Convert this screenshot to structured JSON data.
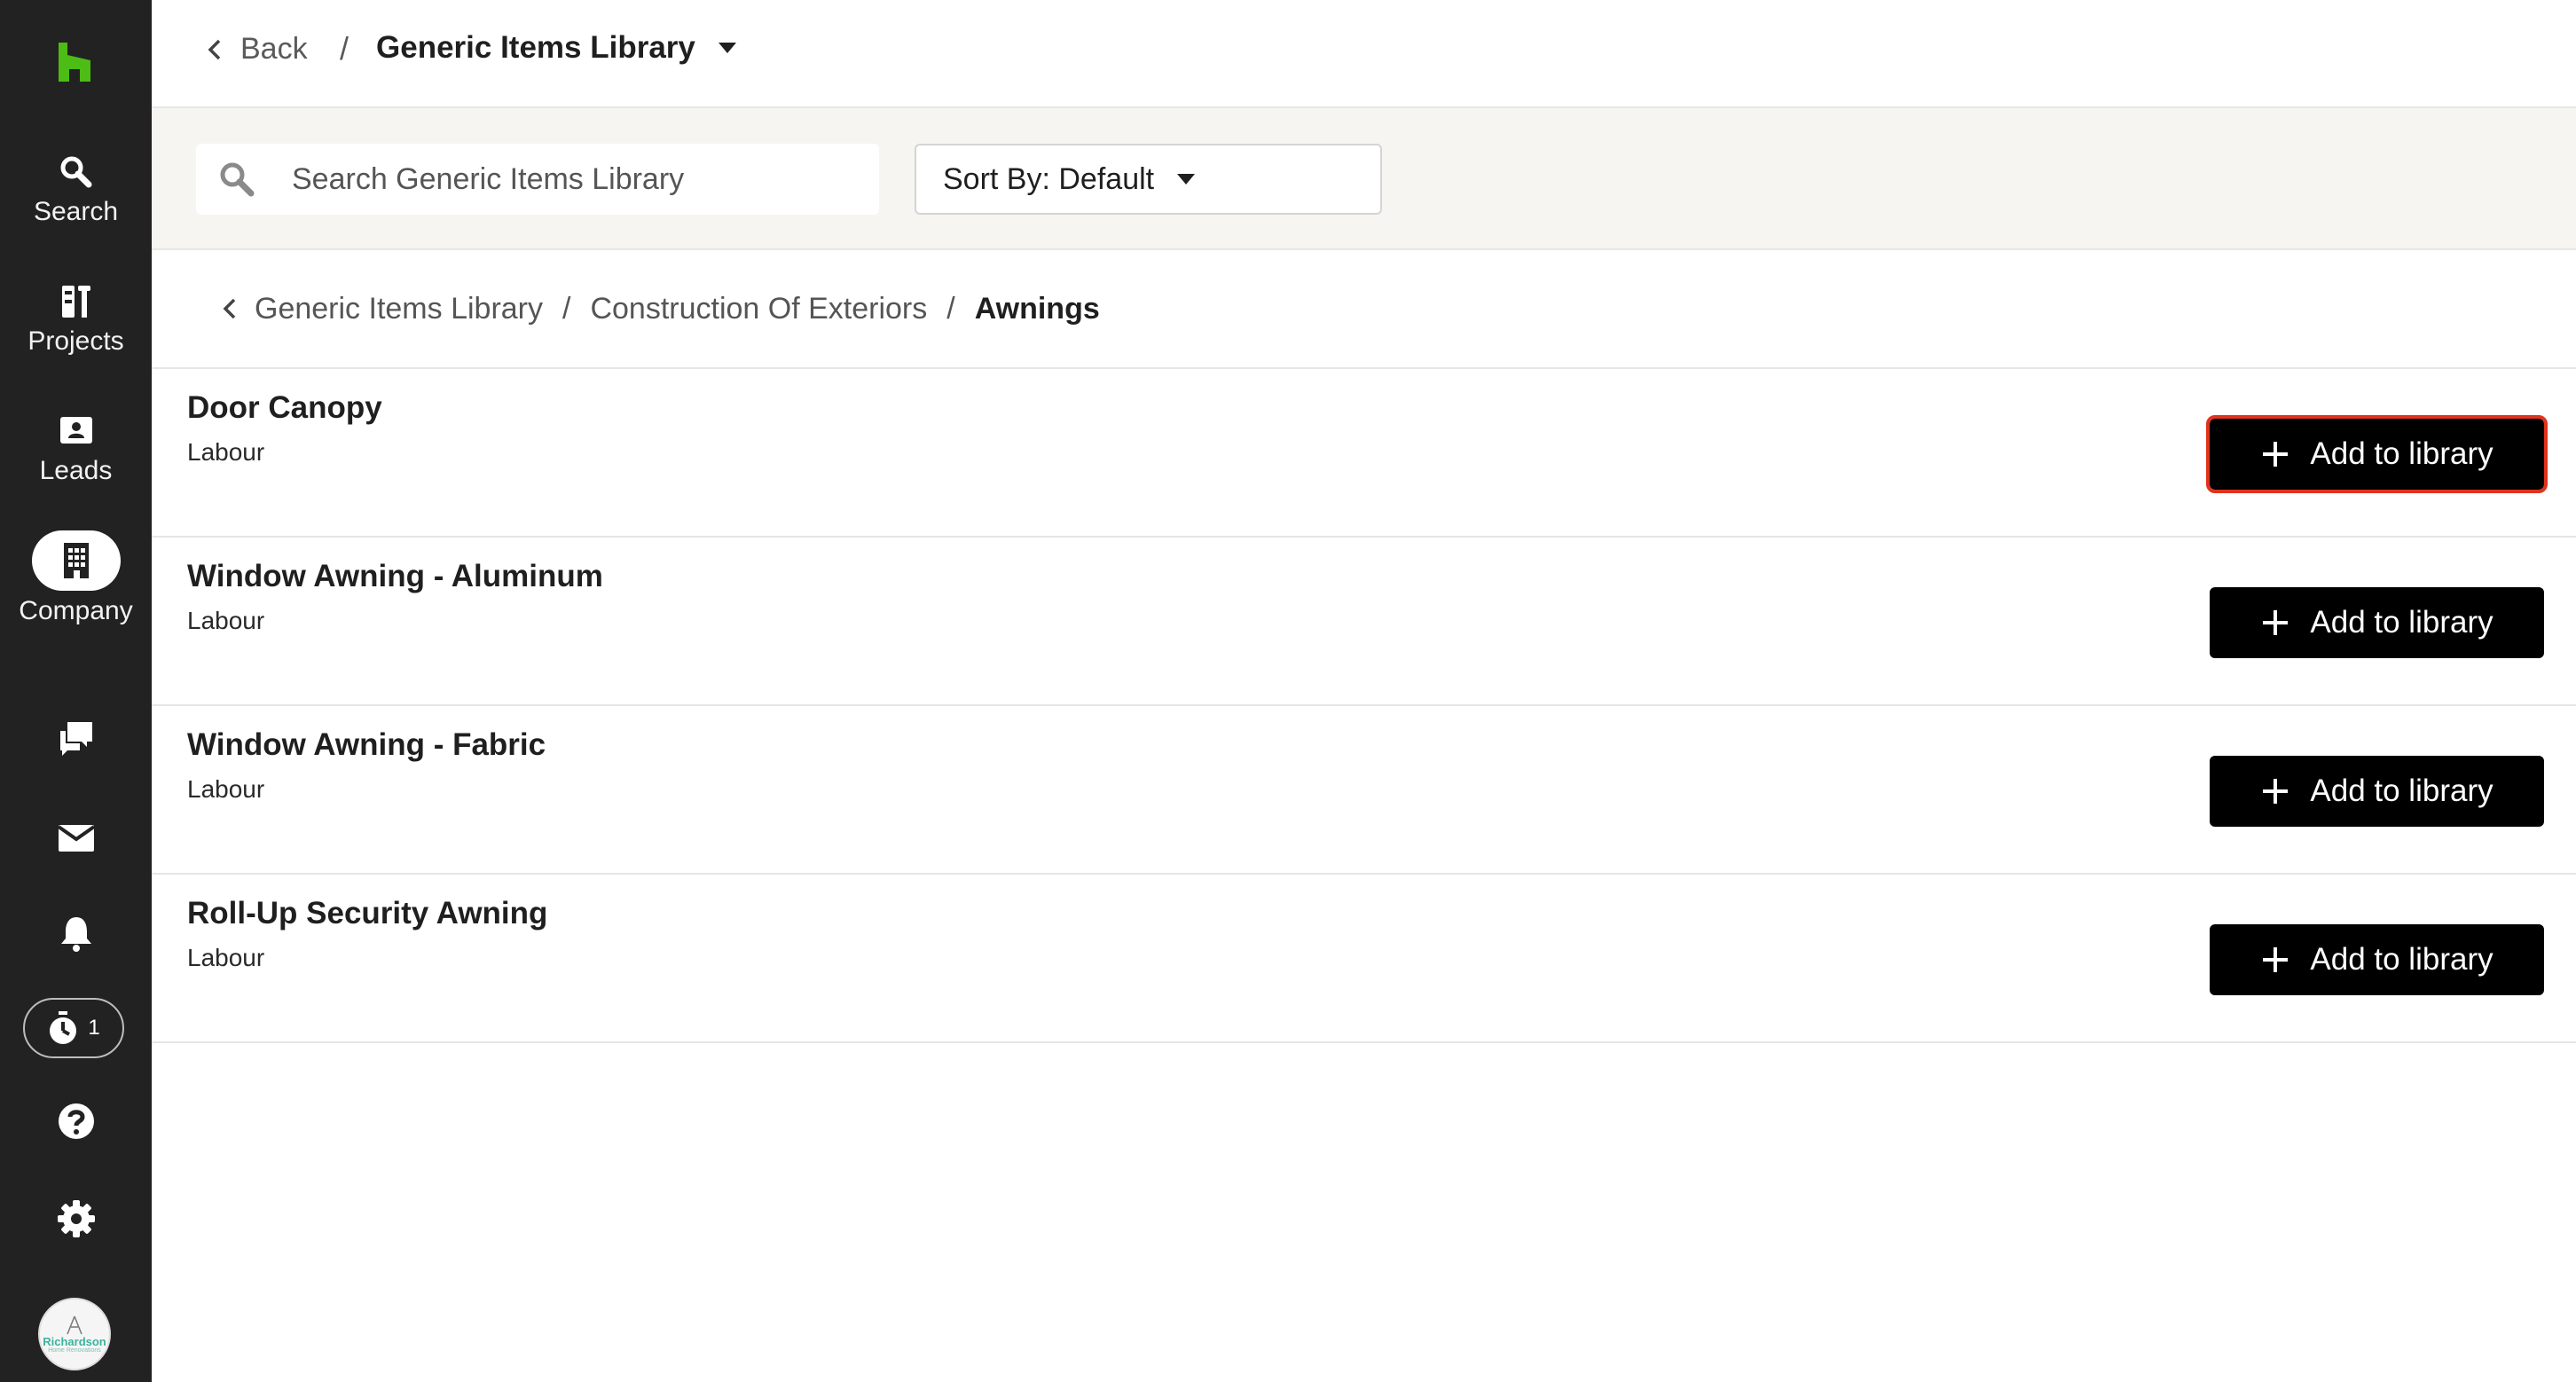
{
  "sidebar": {
    "logo": "houzz-logo",
    "items": [
      {
        "label": "Search",
        "icon": "search-icon"
      },
      {
        "label": "Projects",
        "icon": "projects-icon"
      },
      {
        "label": "Leads",
        "icon": "leads-icon"
      },
      {
        "label": "Company",
        "icon": "company-icon"
      }
    ],
    "icons": [
      "messages-icon",
      "inbox-icon",
      "bell-icon",
      "timer-icon",
      "help-icon",
      "gear-icon"
    ],
    "timer_count": "1",
    "avatar_text": "Richardson",
    "avatar_sub": "Home Renovations"
  },
  "header": {
    "back_label": "Back",
    "separator": "/",
    "library_title": "Generic Items Library"
  },
  "filters": {
    "search_placeholder": "Search Generic Items Library",
    "search_value": "",
    "sort_label": "Sort By: Default"
  },
  "breadcrumb": {
    "items": [
      "Generic Items Library",
      "Construction Of Exteriors",
      "Awnings"
    ],
    "separator": "/"
  },
  "items": [
    {
      "name": "Door Canopy",
      "type": "Labour",
      "button": "Add to library"
    },
    {
      "name": "Window Awning - Aluminum",
      "type": "Labour",
      "button": "Add to library"
    },
    {
      "name": "Window Awning - Fabric",
      "type": "Labour",
      "button": "Add to library"
    },
    {
      "name": "Roll-Up Security Awning",
      "type": "Labour",
      "button": "Add to library"
    }
  ],
  "colors": {
    "sidebar_bg": "#222222",
    "brand_green": "#4dbc15",
    "button_bg": "#000000",
    "focus_outline": "#e0331d",
    "filter_bg": "#f6f5f2"
  }
}
